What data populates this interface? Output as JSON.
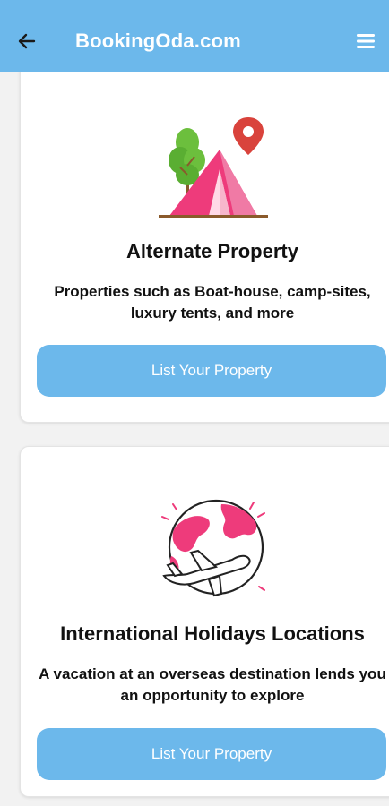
{
  "header": {
    "title": "BookingOda.com",
    "back_icon": "arrow-left-icon",
    "menu_icon": "hamburger-menu-icon",
    "color": "#6cb8eb"
  },
  "cards": [
    {
      "illustration": "tent-camping-illustration",
      "title": "Alternate Property",
      "description": "Properties such as Boat-house, camp-sites, luxury tents, and more",
      "button_label": "List Your Property"
    },
    {
      "illustration": "globe-airplane-illustration",
      "title": "International Holidays Locations",
      "description": "A vacation at an overseas destination lends you an opportunity to explore",
      "button_label": "List Your Property"
    }
  ],
  "colors": {
    "accent": "#6cb8eb",
    "illustration_pink": "#ee3b7b",
    "illustration_green": "#6cbf3d",
    "illustration_red": "#d9433c"
  }
}
